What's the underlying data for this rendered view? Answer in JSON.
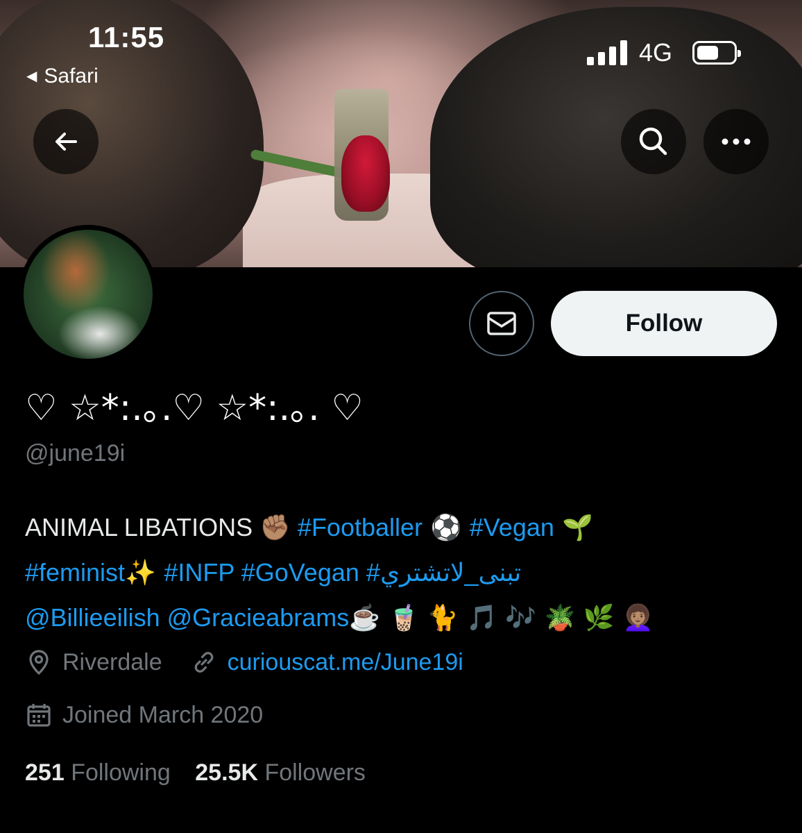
{
  "status_bar": {
    "time": "11:55",
    "back_app": "Safari",
    "network": "4G"
  },
  "profile": {
    "display_name": "♡ ☆*:.｡.♡ ☆*:.｡. ♡",
    "handle": "@june19i",
    "follow_label": "Follow",
    "bio": {
      "line1_text": "ANIMAL LIBATIONS ✊🏽",
      "line1_tag1": "#Footballer",
      "line1_emoji1": " ⚽️ ",
      "line1_tag2": "#Vegan",
      "line1_emoji2": " 🌱",
      "line2_tag1": "#feminist",
      "line2_emoji1": "✨ ",
      "line2_tag2": "#INFP",
      "line2_tag3": "#GoVegan",
      "line2_tag4": "#تبنى_لاتشتري",
      "line3_mention1": "@Billieeilish",
      "line3_mention2": "@Gracieabrams",
      "line3_emojis": "☕️ 🧋 🐈 🎵 🎶 🪴 🌿 👩🏽‍🦱"
    },
    "location": "Riverdale",
    "website": "curiouscat.me/June19i",
    "joined": "Joined March 2020",
    "following_count": "251",
    "following_label": "Following",
    "followers_count": "25.5K",
    "followers_label": "Followers"
  },
  "colors": {
    "accent": "#1d9bf0",
    "muted": "#71767b",
    "background": "#000000"
  }
}
